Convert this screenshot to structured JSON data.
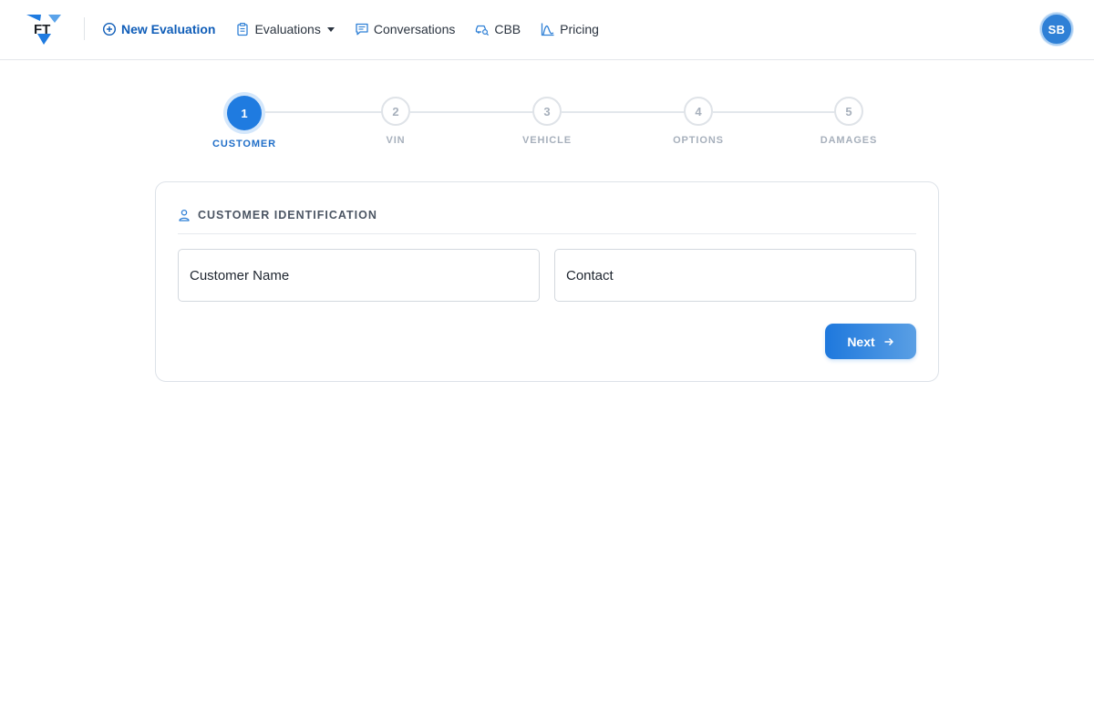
{
  "colors": {
    "brand": "#1f7be0",
    "brand_dark": "#0f5db8",
    "muted": "#a7b0bc",
    "border": "#dde2e8"
  },
  "header": {
    "logo_text": "FT",
    "nav": [
      {
        "label": "New Evaluation",
        "icon": "plus-circle-icon",
        "active": true
      },
      {
        "label": "Evaluations",
        "icon": "clipboard-icon",
        "dropdown": true
      },
      {
        "label": "Conversations",
        "icon": "chat-icon"
      },
      {
        "label": "CBB",
        "icon": "car-search-icon"
      },
      {
        "label": "Pricing",
        "icon": "chart-icon"
      }
    ],
    "avatar_initials": "SB"
  },
  "stepper": {
    "current_step": 1,
    "steps": [
      {
        "number": "1",
        "label": "CUSTOMER"
      },
      {
        "number": "2",
        "label": "VIN"
      },
      {
        "number": "3",
        "label": "VEHICLE"
      },
      {
        "number": "4",
        "label": "OPTIONS"
      },
      {
        "number": "5",
        "label": "DAMAGES"
      }
    ]
  },
  "form": {
    "section_title": "CUSTOMER IDENTIFICATION",
    "section_icon": "user-icon",
    "customer_name_placeholder": "Customer Name",
    "customer_name_value": "",
    "contact_placeholder": "Contact",
    "contact_value": "",
    "next_label": "Next",
    "next_icon": "arrow-right-icon"
  }
}
